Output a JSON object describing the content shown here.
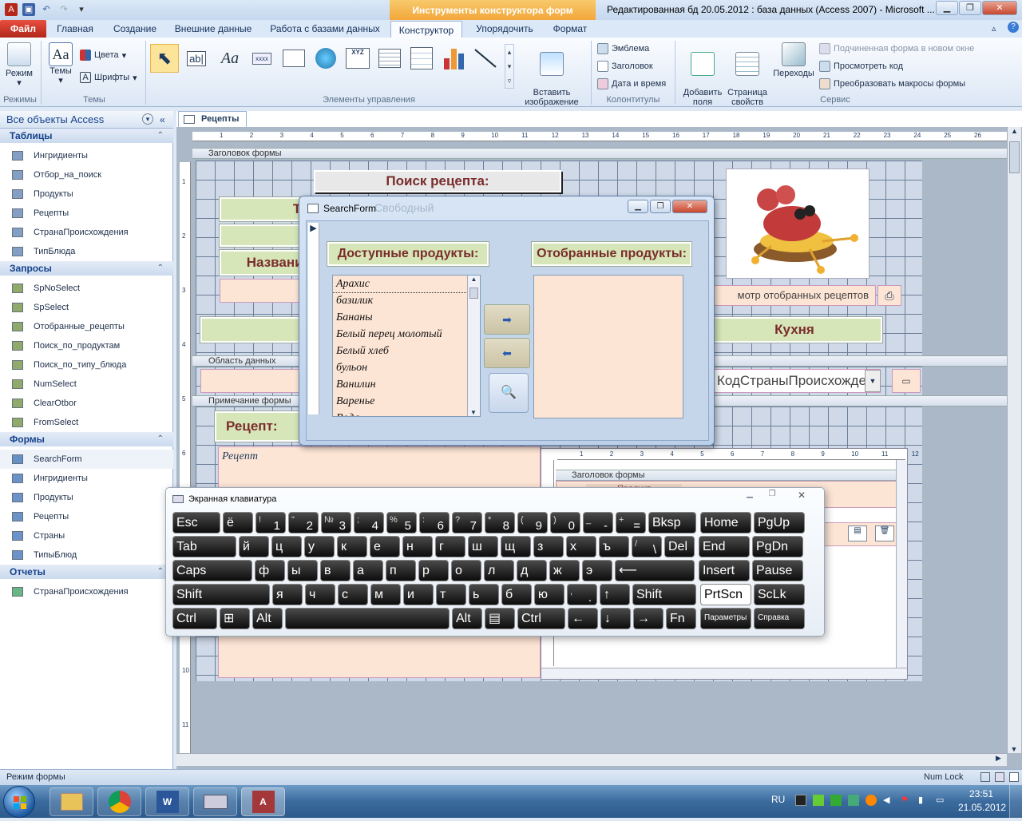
{
  "title_bar": {
    "context_title": "Инструменты конструктора форм",
    "app_title": "Редактированная бд 20.05.2012 : база данных (Access 2007) - Microsoft ...",
    "min": "▁",
    "max": "❐",
    "close": "✕"
  },
  "tabs": {
    "file": "Файл",
    "items": [
      "Главная",
      "Создание",
      "Внешние данные",
      "Работа с базами данных",
      "Конструктор",
      "Упорядочить",
      "Формат"
    ]
  },
  "ribbon": {
    "groups": {
      "modes": "Режимы",
      "themes": "Темы",
      "controls": "Элементы управления",
      "headers": "Колонтитулы",
      "service": "Сервис"
    },
    "mode_btn": "Режим",
    "themes_btn": "Темы",
    "colors_btn": "Цвета",
    "fonts_btn": "Шрифты",
    "insert_image": "Вставить\nизображение",
    "emblem": "Эмблема",
    "header": "Заголовок",
    "datetime": "Дата и время",
    "add_fields": "Добавить\nполя",
    "prop_sheet": "Страница\nсвойств",
    "transitions": "Переходы",
    "subform_new_window": "Подчиненная форма в новом окне",
    "view_code": "Просмотреть код",
    "convert_macros": "Преобразовать макросы формы",
    "textbox_label": "ab|",
    "aa_label": "Aa",
    "xxxx_label": "xxxx",
    "xyz_label": "XYZ"
  },
  "nav": {
    "header": "Все объекты Access",
    "sections": [
      {
        "title": "Таблицы",
        "items": [
          "Ингридиенты",
          "Отбор_на_поиск",
          "Продукты",
          "Рецепты",
          "СтранаПроисхождения",
          "ТипБлюда"
        ]
      },
      {
        "title": "Запросы",
        "items": [
          "SpNoSelect",
          "SpSelect",
          "Отобранные_рецепты",
          "Поиск_по_продуктам",
          "Поиск_по_типу_блюда",
          "NumSelect",
          "ClearOtbor",
          "FromSelect"
        ]
      },
      {
        "title": "Формы",
        "items": [
          "SearchForm",
          "Ингридиенты",
          "Продукты",
          "Рецепты",
          "Страны",
          "ТипыБлюд"
        ]
      },
      {
        "title": "Отчеты",
        "items": [
          "СтранаПроисхождения"
        ]
      }
    ]
  },
  "doc": {
    "tab": "Рецепты",
    "section_header": "Заголовок формы",
    "section_detail": "Область данных",
    "section_footer": "Примечание формы",
    "search_title": "Поиск рецепта:",
    "lbl_ti": "Ти",
    "lbl_name": "Название",
    "lbl_po": "По",
    "lbl_nazv": "Назв",
    "lbl_kitchen": "Кухня",
    "fld_naz": "Наз",
    "fld_country": "КодСтраныПроисхожде",
    "btn_view_selected": "мотр отобранных рецептов",
    "lbl_recipe": "Рецепт:",
    "fld_recipe": "Рецепт",
    "free_text": "Свободный",
    "sub_header": "Заголовок формы",
    "sub_product": "Продукт",
    "ruler_numbers": [
      "1",
      "2",
      "3",
      "4",
      "5",
      "6",
      "7",
      "8",
      "9",
      "10",
      "11",
      "12",
      "13",
      "14",
      "15",
      "16",
      "17",
      "18",
      "19",
      "20",
      "21",
      "22",
      "23",
      "24",
      "25",
      "26"
    ],
    "sub_ruler_numbers": [
      "1",
      "2",
      "3",
      "4",
      "5",
      "6",
      "7",
      "8",
      "9",
      "10",
      "11",
      "12"
    ],
    "vruler_numbers": [
      "1",
      "2",
      "3",
      "4",
      "5",
      "6",
      "7",
      "8",
      "9",
      "10",
      "11"
    ]
  },
  "dialog": {
    "title": "SearchForm",
    "available_label": "Доступные продукты:",
    "selected_label": "Отобранные продукты:",
    "available_items": [
      "Арахис",
      "базилик",
      "Бананы",
      "Белый перец молотый",
      "Белый хлеб",
      "бульон",
      "Ванилин",
      "Варенье",
      "Вода"
    ],
    "btn_add": "➡",
    "btn_remove": "⬅",
    "btn_search": "🔍"
  },
  "keyboard": {
    "title": "Экранная клавиатура",
    "rows": [
      [
        [
          "Esc",
          ""
        ],
        [
          "ё",
          ""
        ],
        [
          "1",
          "!"
        ],
        [
          "2",
          "\""
        ],
        [
          "3",
          "№"
        ],
        [
          "4",
          ";"
        ],
        [
          "5",
          "%"
        ],
        [
          "6",
          ":"
        ],
        [
          "7",
          "?"
        ],
        [
          "8",
          "*"
        ],
        [
          "9",
          "("
        ],
        [
          "0",
          ")"
        ],
        [
          "-",
          "_"
        ],
        [
          "=",
          "+"
        ],
        [
          "Bksp",
          ""
        ],
        [
          "Home",
          ""
        ],
        [
          "PgUp",
          ""
        ]
      ],
      [
        [
          "Tab",
          ""
        ],
        [
          "й",
          ""
        ],
        [
          "ц",
          ""
        ],
        [
          "у",
          ""
        ],
        [
          "к",
          ""
        ],
        [
          "е",
          ""
        ],
        [
          "н",
          ""
        ],
        [
          "г",
          ""
        ],
        [
          "ш",
          ""
        ],
        [
          "щ",
          ""
        ],
        [
          "з",
          ""
        ],
        [
          "х",
          ""
        ],
        [
          "ъ",
          ""
        ],
        [
          "\\",
          "/"
        ],
        [
          "Del",
          ""
        ],
        [
          "End",
          ""
        ],
        [
          "PgDn",
          ""
        ]
      ],
      [
        [
          "Caps",
          ""
        ],
        [
          "ф",
          ""
        ],
        [
          "ы",
          ""
        ],
        [
          "в",
          ""
        ],
        [
          "а",
          ""
        ],
        [
          "п",
          ""
        ],
        [
          "р",
          ""
        ],
        [
          "о",
          ""
        ],
        [
          "л",
          ""
        ],
        [
          "д",
          ""
        ],
        [
          "ж",
          ""
        ],
        [
          "э",
          ""
        ],
        [
          "⟵",
          ""
        ],
        [
          "Insert",
          ""
        ],
        [
          "Pause",
          ""
        ]
      ],
      [
        [
          "Shift",
          ""
        ],
        [
          "я",
          ""
        ],
        [
          "ч",
          ""
        ],
        [
          "с",
          ""
        ],
        [
          "м",
          ""
        ],
        [
          "и",
          ""
        ],
        [
          "т",
          ""
        ],
        [
          "ь",
          ""
        ],
        [
          "б",
          ""
        ],
        [
          "ю",
          ""
        ],
        [
          ".",
          ","
        ],
        [
          "↑",
          ""
        ],
        [
          "Shift",
          ""
        ],
        [
          "PrtScn",
          ""
        ],
        [
          "ScLk",
          ""
        ]
      ],
      [
        [
          "Ctrl",
          ""
        ],
        [
          "⊞",
          ""
        ],
        [
          "Alt",
          ""
        ],
        [
          "",
          ""
        ],
        [
          "Alt",
          ""
        ],
        [
          "▤",
          ""
        ],
        [
          "Ctrl",
          ""
        ],
        [
          "←",
          ""
        ],
        [
          "↓",
          ""
        ],
        [
          "→",
          ""
        ],
        [
          "Fn",
          ""
        ],
        [
          "Параметры",
          ""
        ],
        [
          "Справка",
          ""
        ]
      ]
    ]
  },
  "status": {
    "left": "Режим формы",
    "numlock": "Num Lock"
  },
  "taskbar": {
    "lang": "RU",
    "time": "23:51",
    "date": "21.05.2012"
  }
}
